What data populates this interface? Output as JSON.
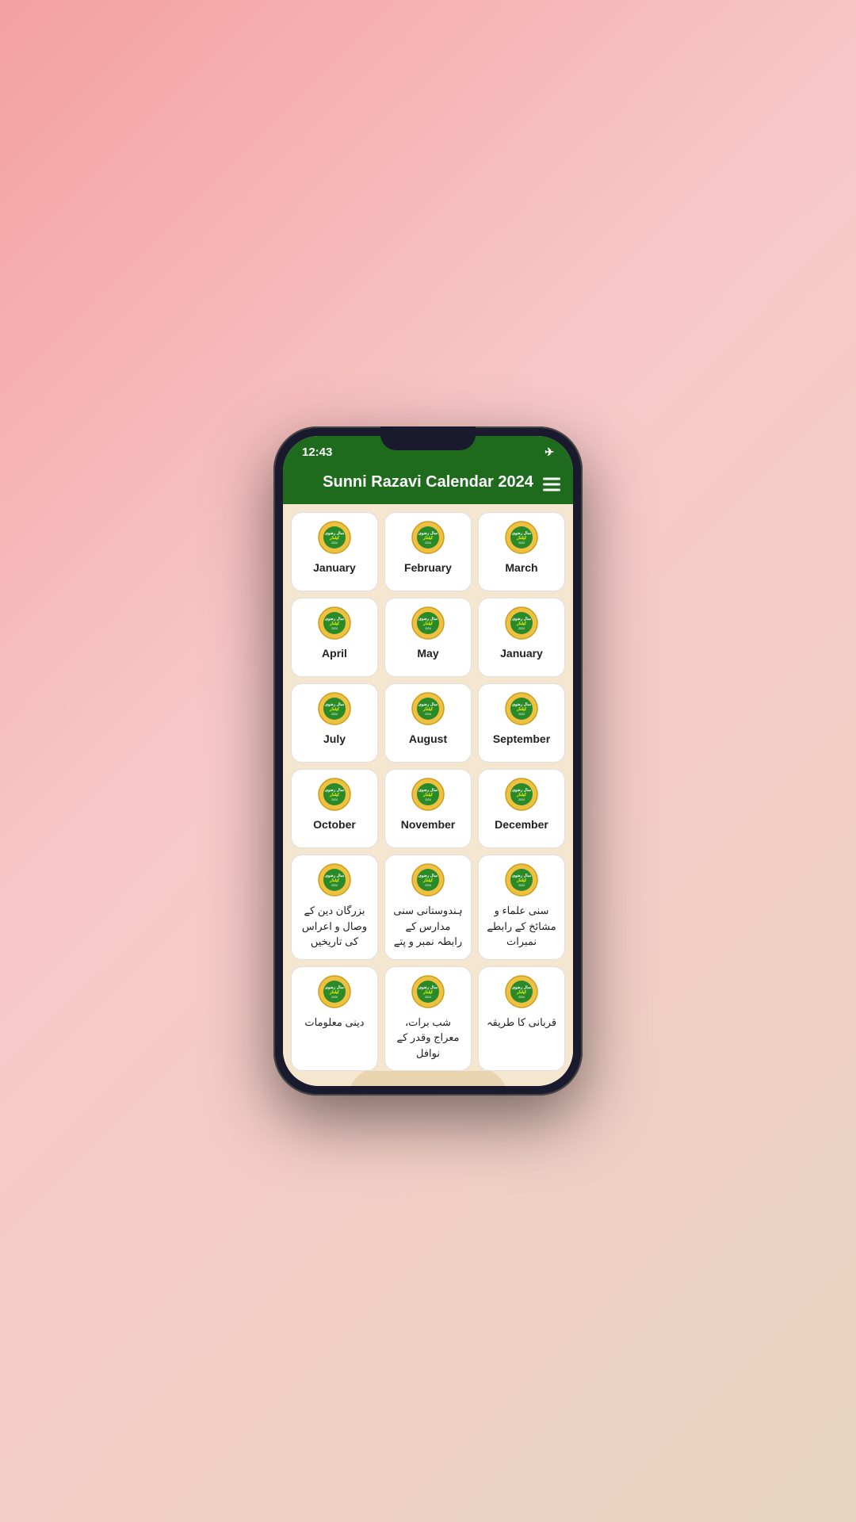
{
  "app": {
    "title": "Sunni Razavi Calendar 2024",
    "status_time": "12:43"
  },
  "months": [
    {
      "id": "january",
      "label": "January"
    },
    {
      "id": "february",
      "label": "February"
    },
    {
      "id": "march",
      "label": "March"
    },
    {
      "id": "april",
      "label": "April"
    },
    {
      "id": "may",
      "label": "May"
    },
    {
      "id": "june",
      "label": "January"
    },
    {
      "id": "july",
      "label": "July"
    },
    {
      "id": "august",
      "label": "August"
    },
    {
      "id": "september",
      "label": "September"
    },
    {
      "id": "october",
      "label": "October"
    },
    {
      "id": "november",
      "label": "November"
    },
    {
      "id": "december",
      "label": "December"
    }
  ],
  "extra_items": [
    {
      "id": "buzurgan",
      "label": "بزرگان دین کے وصال و اعراس کی تاریخیں"
    },
    {
      "id": "hindustan",
      "label": "ہندوستانی سنی مدارس کے رابطہ نمبر و پتے"
    },
    {
      "id": "ulama",
      "label": "سنی علماء و مشائخ کے رابطے نمبرات"
    },
    {
      "id": "deeni",
      "label": "دینی معلومات"
    },
    {
      "id": "shab",
      "label": "شب برات، معراج وقدر کے نوافل"
    },
    {
      "id": "qurbani",
      "label": "قربانی کا طریقہ"
    }
  ]
}
